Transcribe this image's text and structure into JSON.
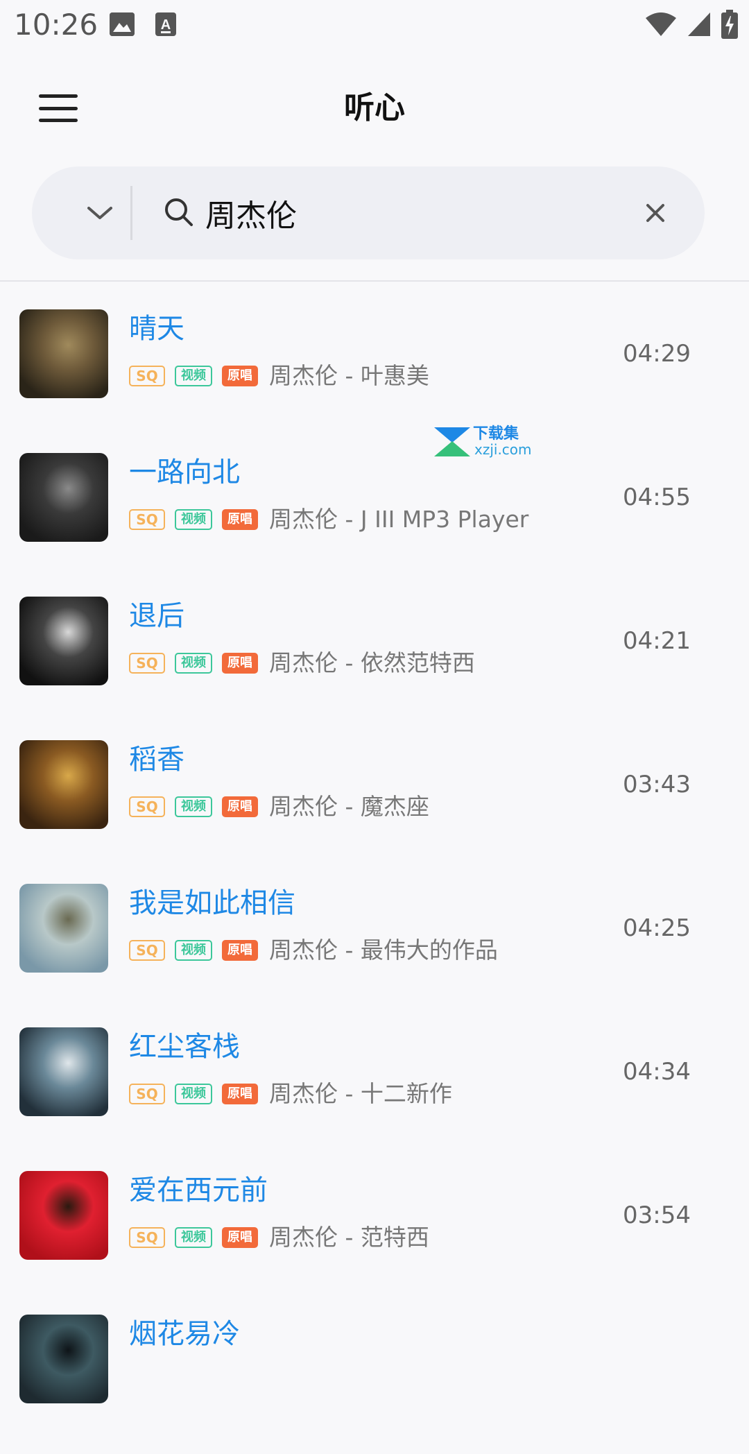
{
  "status_bar": {
    "time": "10:26",
    "notification_icons": [
      "image-icon",
      "text-a-icon"
    ],
    "system_icons": [
      "wifi-icon",
      "cellular-icon",
      "battery-charging-icon"
    ]
  },
  "header": {
    "title": "听心",
    "menu_icon": "hamburger-menu-icon"
  },
  "search": {
    "dropdown_icon": "chevron-down-icon",
    "search_icon": "search-icon",
    "value": "周杰伦",
    "clear_icon": "close-icon"
  },
  "badges": {
    "sq": "SQ",
    "video": "视频",
    "original": "原唱"
  },
  "watermark": {
    "title": "下载集",
    "subtitle": "xzji.com"
  },
  "songs": [
    {
      "title": "晴天",
      "subtitle": "周杰伦 - 叶惠美",
      "duration": "04:29",
      "cover_colors": [
        "#2a2418",
        "#6e5a3a",
        "#a08a5c"
      ]
    },
    {
      "title": "一路向北",
      "subtitle": "周杰伦 - J III MP3 Player",
      "duration": "04:55",
      "cover_colors": [
        "#1a1a1a",
        "#3a3a3a",
        "#8a8a8a"
      ]
    },
    {
      "title": "退后",
      "subtitle": "周杰伦 - 依然范特西",
      "duration": "04:21",
      "cover_colors": [
        "#111111",
        "#444444",
        "#d8d8d8"
      ]
    },
    {
      "title": "稻香",
      "subtitle": "周杰伦 - 魔杰座",
      "duration": "03:43",
      "cover_colors": [
        "#3a2410",
        "#8a5a22",
        "#d8a84a"
      ]
    },
    {
      "title": "我是如此相信",
      "subtitle": "周杰伦 - 最伟大的作品",
      "duration": "04:25",
      "cover_colors": [
        "#7a98a8",
        "#b8c8c8",
        "#6a6a52"
      ]
    },
    {
      "title": "红尘客栈",
      "subtitle": "周杰伦 - 十二新作",
      "duration": "04:34",
      "cover_colors": [
        "#22303a",
        "#6a8898",
        "#dfe6ea"
      ]
    },
    {
      "title": "爱在西元前",
      "subtitle": "周杰伦 - 范特西",
      "duration": "03:54",
      "cover_colors": [
        "#b0101a",
        "#e02030",
        "#2a1a10"
      ]
    },
    {
      "title": "烟花易冷",
      "subtitle": "",
      "duration": "",
      "cover_colors": [
        "#1e2a30",
        "#3e5a62",
        "#0e1418"
      ]
    }
  ]
}
